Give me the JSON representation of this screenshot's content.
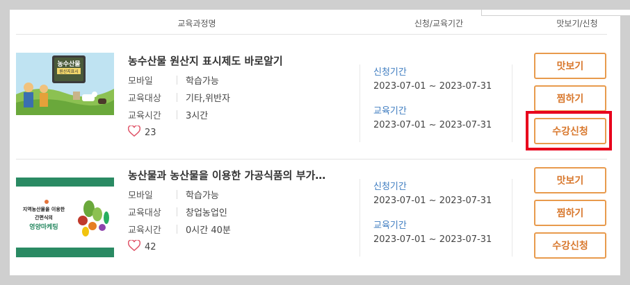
{
  "header": {
    "course": "교육과정명",
    "period": "신청/교육기간",
    "apply": "맛보기/신청"
  },
  "courses": [
    {
      "title": "농수산물 원산지 표시제도 바로알기",
      "meta": [
        {
          "key": "모바일",
          "value": "학습가능"
        },
        {
          "key": "교육대상",
          "value": "기타,위반자"
        },
        {
          "key": "교육시간",
          "value": "3시간"
        }
      ],
      "likes": "23",
      "apply_label": "신청기간",
      "apply_period": "2023-07-01 ~ 2023-07-31",
      "edu_label": "교육기간",
      "edu_period": "2023-07-01 ~ 2023-07-31",
      "buttons": [
        "맛보기",
        "찜하기",
        "수강신청"
      ],
      "thumb_text": {
        "line1": "농수산물",
        "line2": "원산지표시"
      }
    },
    {
      "title": "농산물과 농산물을 이용한 가공식품의 부가…",
      "meta": [
        {
          "key": "모바일",
          "value": "학습가능"
        },
        {
          "key": "교육대상",
          "value": "창업농업인"
        },
        {
          "key": "교육시간",
          "value": "0시간 40분"
        }
      ],
      "likes": "42",
      "apply_label": "신청기간",
      "apply_period": "2023-07-01 ~ 2023-07-31",
      "edu_label": "교육기간",
      "edu_period": "2023-07-01 ~ 2023-07-31",
      "buttons": [
        "맛보기",
        "찜하기",
        "수강신청"
      ],
      "thumb_text": {
        "line1": "지역농산물을 이용한",
        "line2": "간편식의",
        "line3": "영양마케팅"
      }
    }
  ],
  "colors": {
    "accent": "#d8772c",
    "period_label": "#3e7cc0",
    "highlight": "#e8001c",
    "thumb_green": "#2a8a63"
  },
  "icons": [
    "heart-icon"
  ]
}
